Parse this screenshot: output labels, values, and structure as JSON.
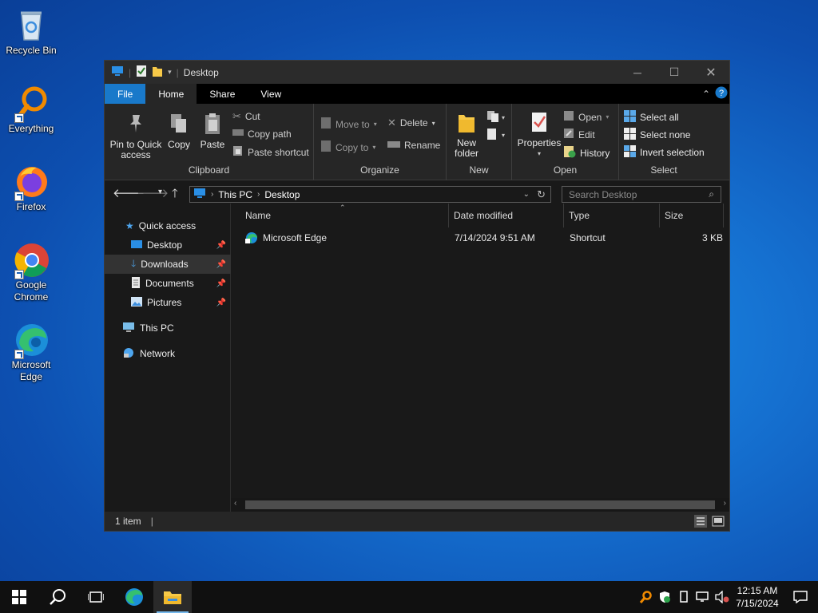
{
  "desktop": {
    "icons": [
      {
        "label": "Recycle Bin",
        "icon": "recycle-bin-icon"
      },
      {
        "label": "Everything",
        "icon": "everything-search-icon"
      },
      {
        "label": "Firefox",
        "icon": "firefox-icon"
      },
      {
        "label": "Google Chrome",
        "icon": "chrome-icon"
      },
      {
        "label": "Microsoft Edge",
        "icon": "edge-icon"
      }
    ]
  },
  "window": {
    "title": "Desktop",
    "tabs": {
      "file": "File",
      "home": "Home",
      "share": "Share",
      "view": "View"
    },
    "ribbon": {
      "clipboard": {
        "group": "Clipboard",
        "pin": "Pin to Quick access",
        "copy": "Copy",
        "paste": "Paste",
        "cut": "Cut",
        "copy_path": "Copy path",
        "paste_shortcut": "Paste shortcut"
      },
      "organize": {
        "group": "Organize",
        "move_to": "Move to",
        "copy_to": "Copy to",
        "delete": "Delete",
        "rename": "Rename"
      },
      "new": {
        "group": "New",
        "new_folder": "New folder"
      },
      "open": {
        "group": "Open",
        "properties": "Properties",
        "open": "Open",
        "edit": "Edit",
        "history": "History"
      },
      "select": {
        "group": "Select",
        "select_all": "Select all",
        "select_none": "Select none",
        "invert": "Invert selection"
      }
    },
    "address": {
      "crumbs": [
        "This PC",
        "Desktop"
      ],
      "search_placeholder": "Search Desktop"
    },
    "nav": {
      "quick_access": "Quick access",
      "desktop": "Desktop",
      "downloads": "Downloads",
      "documents": "Documents",
      "pictures": "Pictures",
      "this_pc": "This PC",
      "network": "Network"
    },
    "columns": {
      "name": "Name",
      "date": "Date modified",
      "type": "Type",
      "size": "Size"
    },
    "files": [
      {
        "name": "Microsoft Edge",
        "date": "7/14/2024 9:51 AM",
        "type": "Shortcut",
        "size": "3 KB"
      }
    ],
    "status": "1 item"
  },
  "taskbar": {
    "time": "12:15 AM",
    "date": "7/15/2024"
  },
  "colors": {
    "accent": "#1979ca",
    "window_bg": "#191919",
    "ribbon_bg": "#262626",
    "taskbar_bg": "#101010"
  }
}
